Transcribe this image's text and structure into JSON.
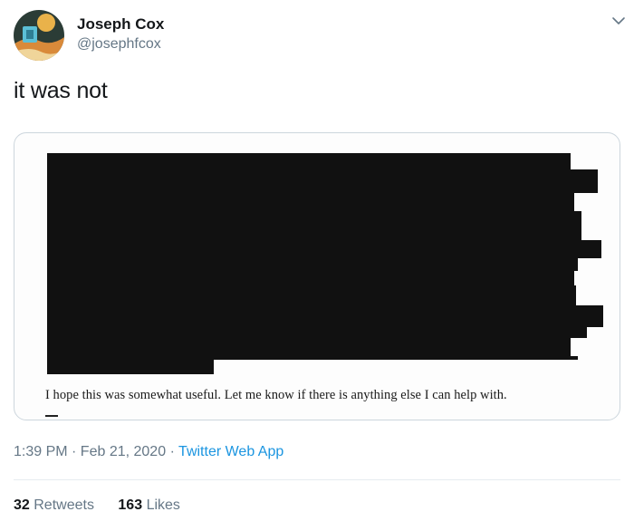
{
  "author": {
    "display_name": "Joseph Cox",
    "handle": "@josephfcox"
  },
  "tweet": {
    "text": "it was not",
    "timestamp": "1:39 PM · Feb 21, 2020",
    "separator": "·",
    "source": "Twitter Web App"
  },
  "media": {
    "document_line": "I hope this was somewhat useful.  Let me know if there is anything else I can help with."
  },
  "stats": {
    "retweets_count": "32",
    "retweets_label": "Retweets",
    "likes_count": "163",
    "likes_label": "Likes"
  },
  "colors": {
    "text": "#14171a",
    "secondary": "#657786",
    "link": "#1b95e0",
    "border": "#ccd6dd",
    "redaction": "#111111"
  }
}
